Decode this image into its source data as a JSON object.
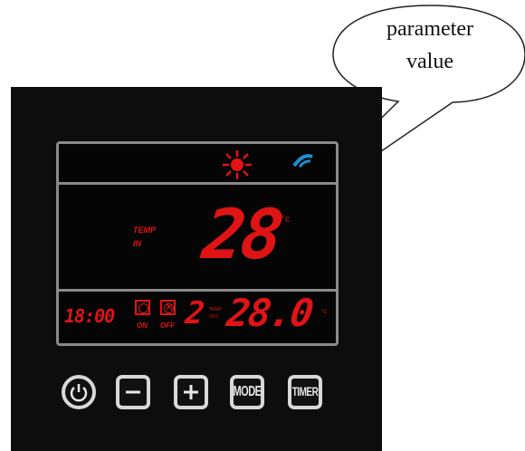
{
  "callout": {
    "line1": "parameter",
    "line2": "value"
  },
  "display": {
    "temp_in_label_1": "TEMP",
    "temp_in_label_2": "IN",
    "main_temp": "28",
    "main_unit": "°c",
    "clock": "18:00",
    "timer_on_label": "ON",
    "timer_off_label": "OFF",
    "mode_digit": "2",
    "temp_out_label_1": "TEMP",
    "temp_out_label_2": "OUT",
    "out_temp": "28.0",
    "out_unit": "°c",
    "segment_color": "#e01414",
    "heat_icon": "sun-icon",
    "wifi_icon": "wifi-icon"
  },
  "buttons": {
    "power": {
      "icon": "power-icon"
    },
    "minus": {
      "icon": "minus-icon"
    },
    "plus": {
      "icon": "plus-icon"
    },
    "mode_label": "MODE",
    "timer_label": "TIMER"
  }
}
